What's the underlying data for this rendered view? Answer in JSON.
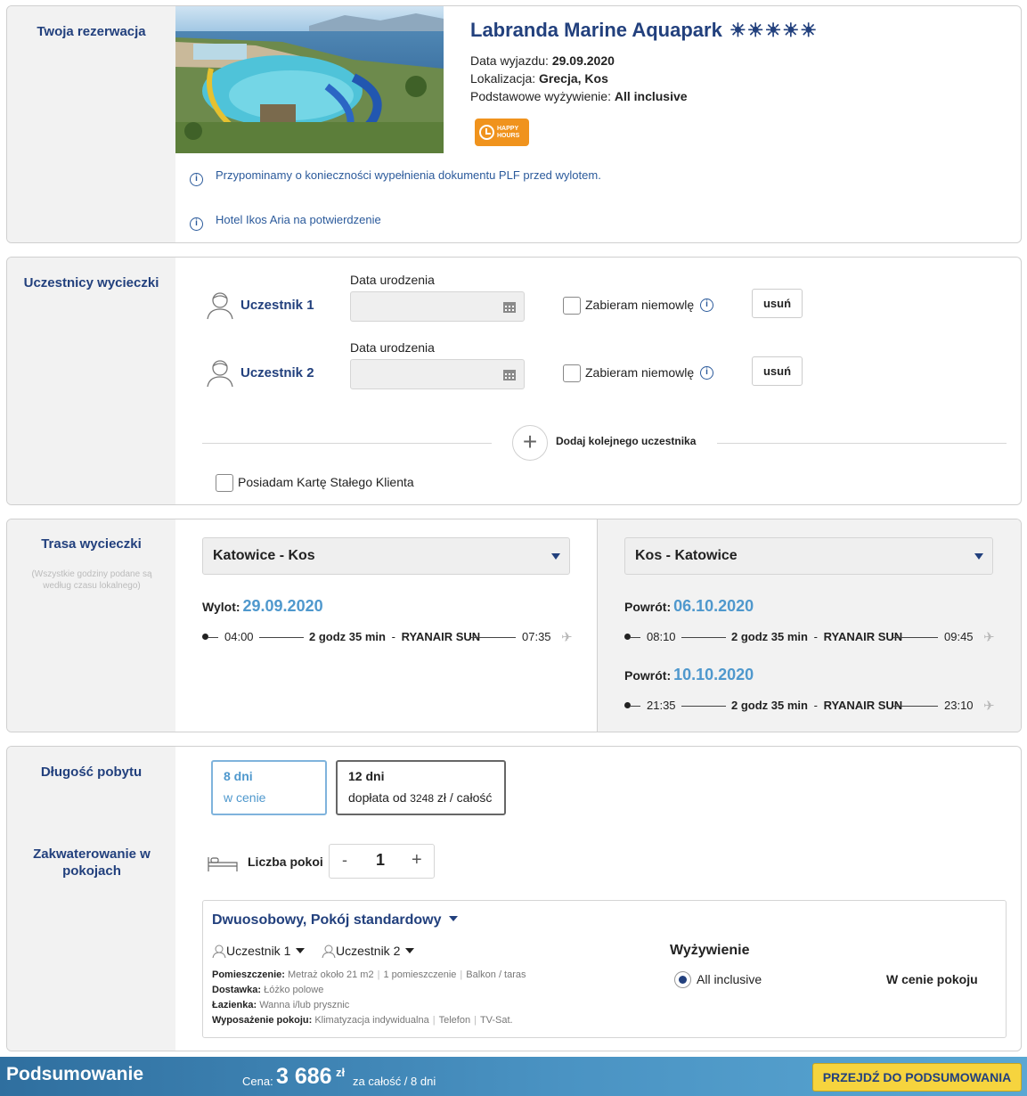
{
  "reservation": {
    "section_title": "Twoja rezerwacja",
    "hotel_name": "Labranda Marine Aquapark",
    "stars": "☀☀☀☀☀",
    "departure_label": "Data wyjazdu:",
    "departure_value": "29.09.2020",
    "location_label": "Lokalizacja:",
    "location_value": "Grecja, Kos",
    "board_label": "Podstawowe wyżywienie:",
    "board_value": "All inclusive",
    "badge_line1": "HAPPY",
    "badge_line2": "HOURS",
    "info": [
      "Przypominamy o konieczności wypełnienia dokumentu PLF przed wylotem.",
      "Hotel Ikos Aria na potwierdzenie"
    ]
  },
  "participants": {
    "section_title": "Uczestnicy wycieczki",
    "birth_label": "Data urodzenia",
    "list": [
      {
        "name": "Uczestnik 1",
        "infant_label": "Zabieram niemowlę",
        "remove_label": "usuń"
      },
      {
        "name": "Uczestnik 2",
        "infant_label": "Zabieram niemowlę",
        "remove_label": "usuń"
      }
    ],
    "add_label": "Dodaj kolejnego uczestnika",
    "loyalty_label": "Posiadam Kartę Stałego Klienta"
  },
  "route": {
    "section_title": "Trasa wycieczki",
    "note": "(Wszystkie godziny podane są według czasu lokalnego)",
    "outbound": {
      "select": "Katowice - Kos",
      "head_label": "Wylot:",
      "date": "29.09.2020",
      "dep": "04:00",
      "duration": "2 godz 35 min",
      "airline": "RYANAIR SUN",
      "arr": "07:35"
    },
    "inbound": {
      "select": "Kos - Katowice",
      "flights": [
        {
          "head_label": "Powrót:",
          "date": "06.10.2020",
          "dep": "08:10",
          "duration": "2 godz 35 min",
          "airline": "RYANAIR SUN",
          "arr": "09:45"
        },
        {
          "head_label": "Powrót:",
          "date": "10.10.2020",
          "dep": "21:35",
          "duration": "2 godz 35 min",
          "airline": "RYANAIR SUN",
          "arr": "23:10"
        }
      ]
    },
    "dash": "-"
  },
  "stay": {
    "section_title": "Długość pobytu",
    "options": [
      {
        "days": "8 dni",
        "price": "w cenie"
      },
      {
        "days": "12 dni",
        "price_prefix": "dopłata od",
        "amount": "3248",
        "price_suffix": "zł / całość"
      }
    ]
  },
  "accommodation": {
    "section_title": "Zakwaterowanie w pokojach",
    "rooms_label": "Liczba pokoi",
    "rooms_value": "1",
    "minus": "-",
    "plus": "+",
    "room_type": "Dwuosobowy, Pokój standardowy",
    "occupants": [
      "Uczestnik 1",
      "Uczestnik 2"
    ],
    "specs": [
      {
        "label": "Pomieszczenie:",
        "values": [
          "Metraż około 21 m2",
          "1 pomieszczenie",
          "Balkon / taras"
        ]
      },
      {
        "label": "Dostawka:",
        "values": [
          "Łóżko polowe"
        ]
      },
      {
        "label": "Łazienka:",
        "values": [
          "Wanna i/lub prysznic"
        ]
      },
      {
        "label": "Wyposażenie pokoju:",
        "values": [
          "Klimatyzacja indywidualna",
          "Telefon",
          "TV-Sat."
        ]
      }
    ],
    "meal_title": "Wyżywienie",
    "meal_option": "All inclusive",
    "meal_price": "W cenie pokoju"
  },
  "summary": {
    "title": "Podsumowanie",
    "price_label": "Cena:",
    "price": "3 686",
    "currency": "zł",
    "note": "za całość / 8 dni",
    "button": "PRZEJDŹ DO PODSUMOWANIA"
  },
  "colors": {
    "primary": "#22407d",
    "link": "#2b5a9b",
    "date": "#4f98cd",
    "badge": "#f0931d",
    "button": "#f6d43e"
  }
}
